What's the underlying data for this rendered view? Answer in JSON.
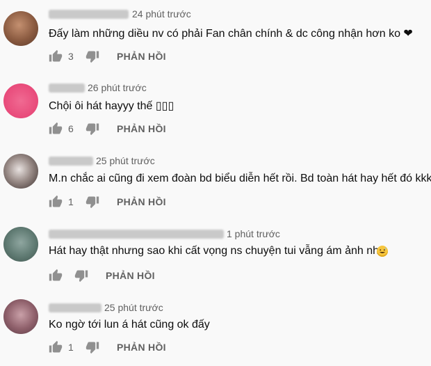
{
  "colors": {
    "background": "#f9f9f9",
    "meta_text": "#606060",
    "body_text": "#0d0d0d",
    "icon": "#909090"
  },
  "icons": {
    "like": "thumbs-up-icon",
    "dislike": "thumbs-down-icon",
    "emoji": "grinning-sweat-icon"
  },
  "comments": [
    {
      "time": "24 phút trước",
      "text": "Đấy làm những diều nv có phải Fan chân chính & dc công nhận hơn ko ❤",
      "likes": "3",
      "reply_label": "PHẢN HỒI"
    },
    {
      "time": "26 phút trước",
      "text": "Chội ôi hát hayyy thế ▯▯▯",
      "likes": "6",
      "reply_label": "PHẢN HỒI"
    },
    {
      "time": "25 phút trước",
      "text": "M.n chắc ai cũng đi xem đoàn bd biểu diễn hết rồi. Bd toàn hát hay hết đó kkk",
      "likes": "1",
      "reply_label": "PHẢN HỒI"
    },
    {
      "time": "1 phút trước",
      "text": "Hát hay thật nhưng sao khi cất vọng ns chuyện tui vẫng ám ảnh nha",
      "likes": "",
      "reply_label": "PHẢN HỒI"
    },
    {
      "time": "25 phút trước",
      "text": "Ko ngờ tới lun á hát cũng ok đấy",
      "likes": "1",
      "reply_label": "PHẢN HỒI"
    }
  ]
}
